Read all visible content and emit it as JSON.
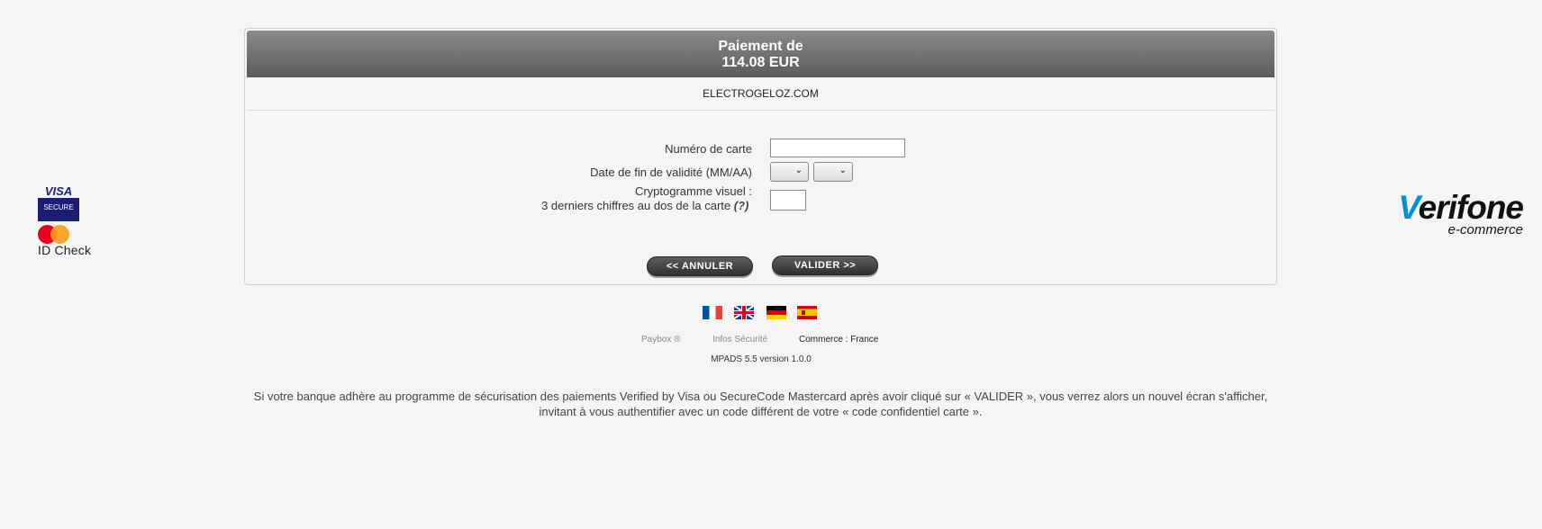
{
  "payment": {
    "header_line1": "Paiement de",
    "header_line2": "114.08 EUR",
    "merchant": "ELECTROGELOZ.COM"
  },
  "form": {
    "card_number_label": "Numéro de carte",
    "card_number_value": "",
    "expiry_label": "Date de fin de validité (MM/AA)",
    "expiry_month_value": "",
    "expiry_year_value": "",
    "cvv_label_line1": "Cryptogramme visuel :",
    "cvv_label_line2": "3 derniers chiffres au dos de la carte",
    "cvv_help": "(?)",
    "cvv_value": ""
  },
  "buttons": {
    "cancel": "<<  ANNULER",
    "validate": "VALIDER  >>"
  },
  "logos": {
    "visa_word": "VISA",
    "visa_secure": "SECURE",
    "mastercard_idcheck": "ID Check",
    "verifone_v": "V",
    "verifone_rest": "erifone",
    "verifone_tagline": "e-commerce",
    "visa_color": "#1a1f71",
    "verifone_accent": "#0092d0"
  },
  "languages": [
    "fr",
    "en",
    "de",
    "es"
  ],
  "footer": {
    "paybox": "Paybox ®",
    "infos_securite": "Infos Sécurité",
    "commerce": "Commerce : France",
    "version": "MPADS 5.5 version 1.0.0"
  },
  "notice": {
    "line1": "Si votre banque adhère au programme de sécurisation des paiements Verified by Visa ou SecureCode Mastercard après avoir cliqué sur « VALIDER », vous verrez alors un nouvel écran s'afficher,",
    "line2": "invitant à vous authentifier avec un code différent de votre « code confidentiel carte »."
  }
}
